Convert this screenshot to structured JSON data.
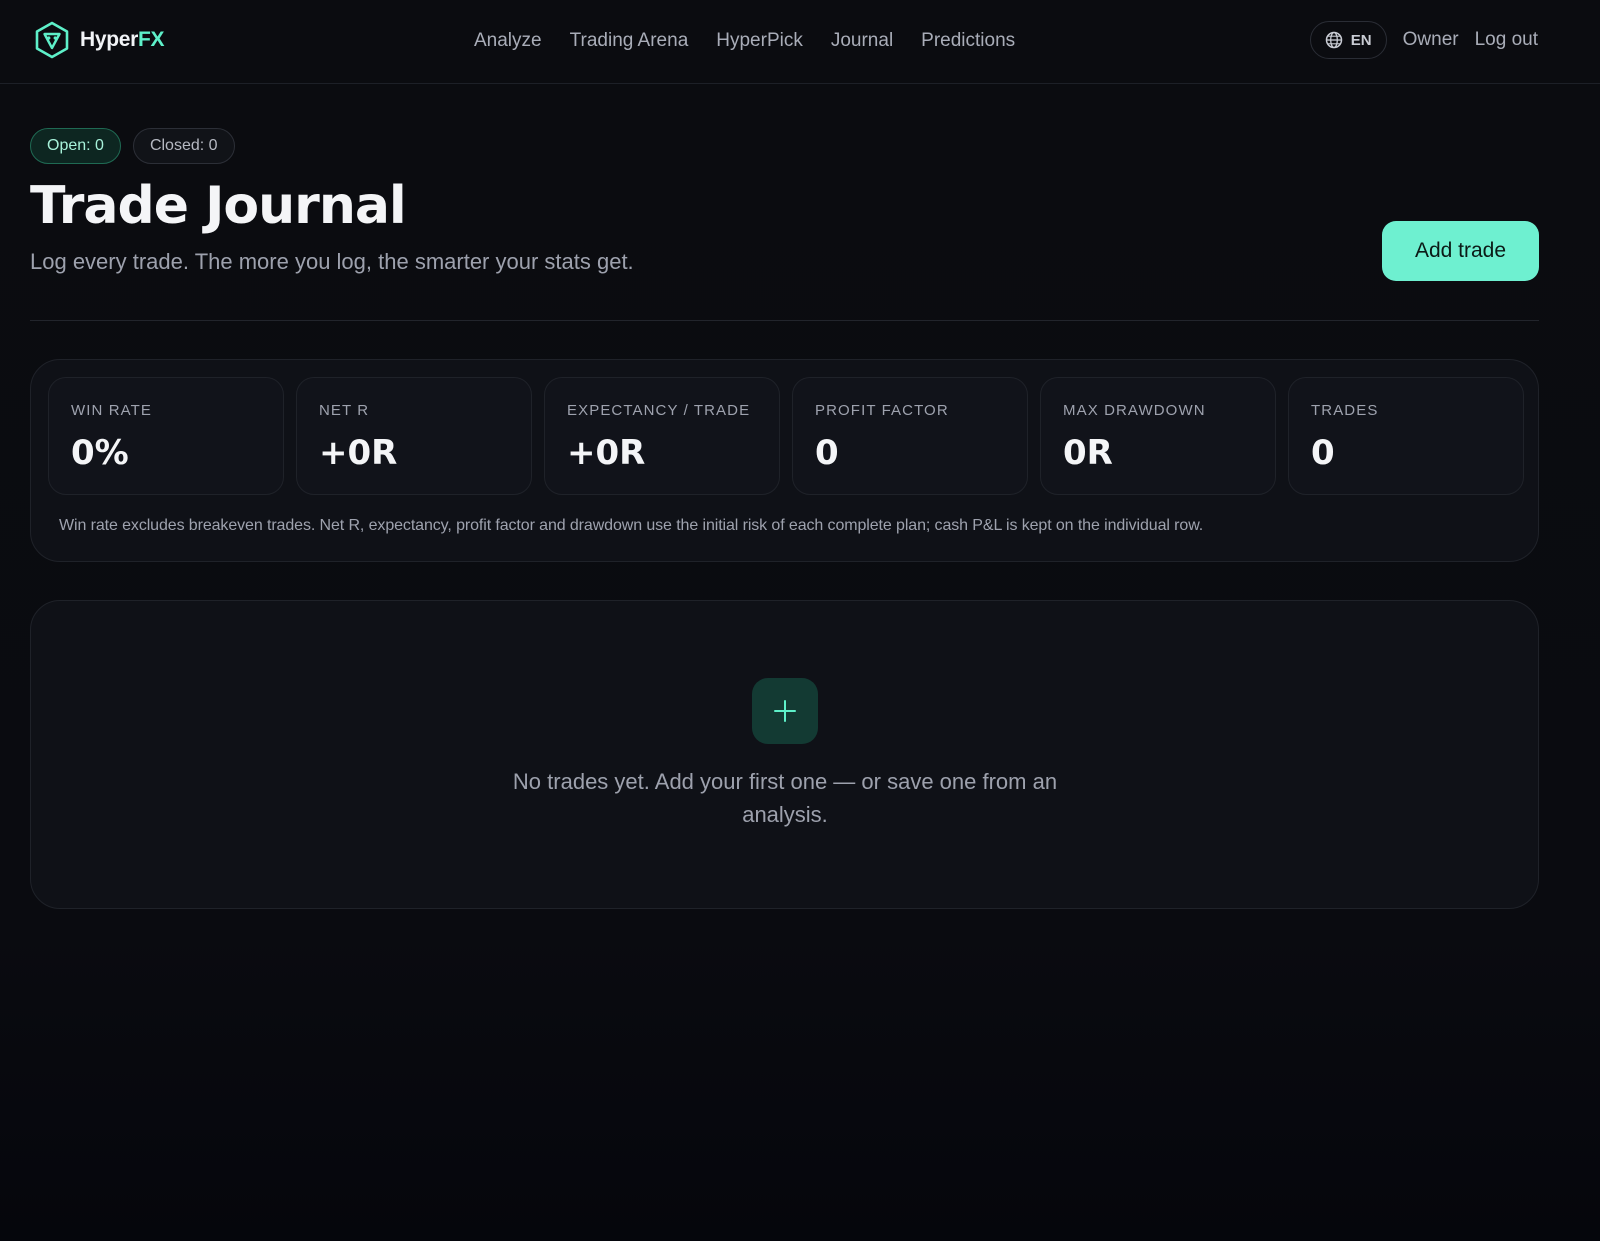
{
  "brand": {
    "name_part1": "Hyper",
    "name_part2": "FX",
    "accent_color": "#5ef0c9"
  },
  "nav": {
    "items": [
      "Analyze",
      "Trading Arena",
      "HyperPick",
      "Journal",
      "Predictions"
    ],
    "language": "EN",
    "language_icon": "globe-icon",
    "user": "Owner",
    "logout": "Log out"
  },
  "header": {
    "open_badge": "Open: 0",
    "closed_badge": "Closed: 0",
    "title": "Trade Journal",
    "subtitle": "Log every trade. The more you log, the smarter your stats get.",
    "add_button": "Add trade"
  },
  "stats": {
    "cards": [
      {
        "label": "WIN RATE",
        "value": "0%"
      },
      {
        "label": "NET R",
        "value": "+0R"
      },
      {
        "label": "EXPECTANCY / TRADE",
        "value": "+0R"
      },
      {
        "label": "PROFIT FACTOR",
        "value": "0"
      },
      {
        "label": "MAX DRAWDOWN",
        "value": "0R"
      },
      {
        "label": "TRADES",
        "value": "0"
      }
    ],
    "note": "Win rate excludes breakeven trades. Net R, expectancy, profit factor and drawdown use the initial risk of each complete plan; cash P&L is kept on the individual row."
  },
  "empty_state": {
    "icon": "plus-icon",
    "message": "No trades yet. Add your first one — or save one from an analysis."
  }
}
